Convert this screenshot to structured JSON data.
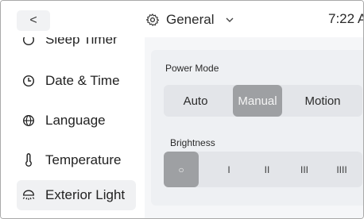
{
  "topbar": {
    "back_label": "<",
    "category": "General",
    "category_icon": "gear-icon",
    "dropdown_icon": "chevron-down-icon",
    "time": "7:22 A"
  },
  "sidebar": {
    "items": [
      {
        "label": "Sleep Timer",
        "icon": "timer-icon"
      },
      {
        "label": "Date & Time",
        "icon": "clock-icon"
      },
      {
        "label": "Language",
        "icon": "globe-icon"
      },
      {
        "label": "Temperature",
        "icon": "thermometer-icon"
      },
      {
        "label": "Exterior Light",
        "icon": "light-icon",
        "active": true
      }
    ]
  },
  "main": {
    "power_mode": {
      "label": "Power Mode",
      "options": [
        "Auto",
        "Manual",
        "Motion"
      ],
      "selected": "Manual"
    },
    "brightness": {
      "label": "Brightness",
      "options": [
        "○",
        "I",
        "II",
        "III",
        "IIII"
      ],
      "selected": "○"
    }
  },
  "colors": {
    "selected_bg": "#9ea0a3",
    "segment_bg": "#e3e5e9",
    "panel_bg": "#f5f6f8",
    "active_item_bg": "#f0f1f3"
  }
}
